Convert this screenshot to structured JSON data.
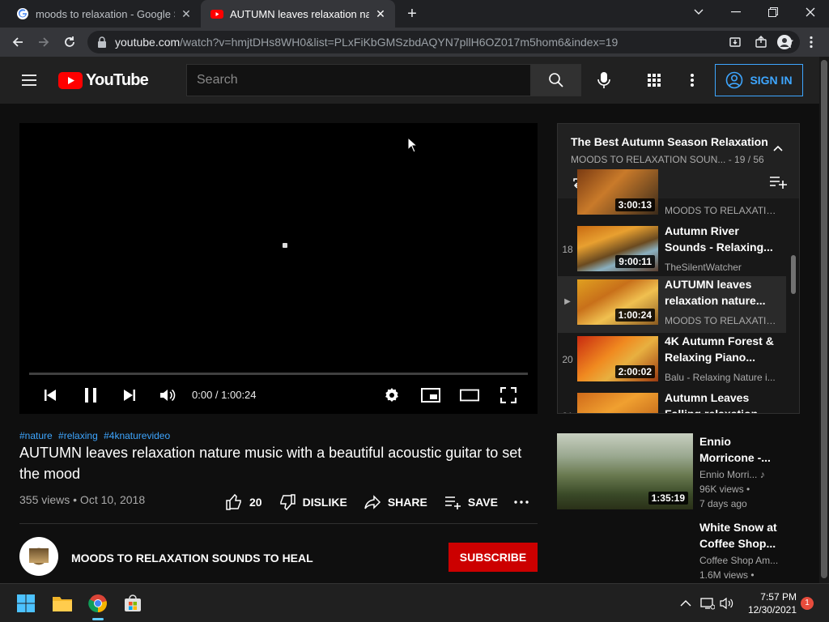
{
  "browser": {
    "tabs": [
      {
        "title": "moods to relaxation - Google Search"
      },
      {
        "title": "AUTUMN leaves relaxation nature music with a beautiful acoustic guitar to set the mood - YouTube"
      }
    ],
    "url_host": "youtube.com",
    "url_rest": "/watch?v=hmjtDHs8WH0&list=PLxFiKbGMSzbdAQYN7pllH6OZ017m5hom6&index=19"
  },
  "youtube": {
    "logo_text": "YouTube",
    "search_placeholder": "Search",
    "sign_in": "SIGN IN"
  },
  "player": {
    "time": "0:00 / 1:00:24",
    "progress": 0
  },
  "video": {
    "tags": [
      "#nature",
      "#relaxing",
      "#4knaturevideo"
    ],
    "title": "AUTUMN leaves relaxation nature music with a beautiful acoustic guitar to set the mood",
    "meta": "355 views • Oct 10, 2018",
    "likes": "20",
    "dislike": "DISLIKE",
    "share": "SHARE",
    "save": "SAVE",
    "channel": "MOODS TO RELAXATION SOUNDS TO HEAL",
    "subscribe": "SUBSCRIBE"
  },
  "playlist": {
    "title": "The Best Autumn Season Relaxation",
    "subtitle": "MOODS TO RELAXATION SOUN... - 19 / 56",
    "items": [
      {
        "index": "",
        "title": "",
        "channel": "MOODS TO RELAXATIO...",
        "duration": "3:00:13"
      },
      {
        "index": "18",
        "title": "Autumn River Sounds - Relaxing...",
        "channel": "TheSilentWatcher",
        "duration": "9:00:11"
      },
      {
        "index": "▶",
        "title": "AUTUMN leaves relaxation nature...",
        "channel": "MOODS TO RELAXATIO...",
        "duration": "1:00:24"
      },
      {
        "index": "20",
        "title": "4K Autumn Forest & Relaxing Piano...",
        "channel": "Balu - Relaxing Nature i...",
        "duration": "2:00:02"
      },
      {
        "index": "21",
        "title": "Autumn Leaves Falling relaxation...",
        "channel": "",
        "duration": ""
      }
    ]
  },
  "recommendations": [
    {
      "title": "Ennio Morricone -...",
      "channel": "Ennio Morri...",
      "views": "96K views •",
      "age": "7 days ago",
      "duration": "1:35:19"
    },
    {
      "title": "White Snow at Coffee Shop...",
      "channel": "Coffee Shop Am...",
      "views": "1.6M views •",
      "age": "",
      "duration": ""
    }
  ],
  "taskbar": {
    "time": "7:57 PM",
    "date": "12/30/2021",
    "notifications": "1"
  }
}
